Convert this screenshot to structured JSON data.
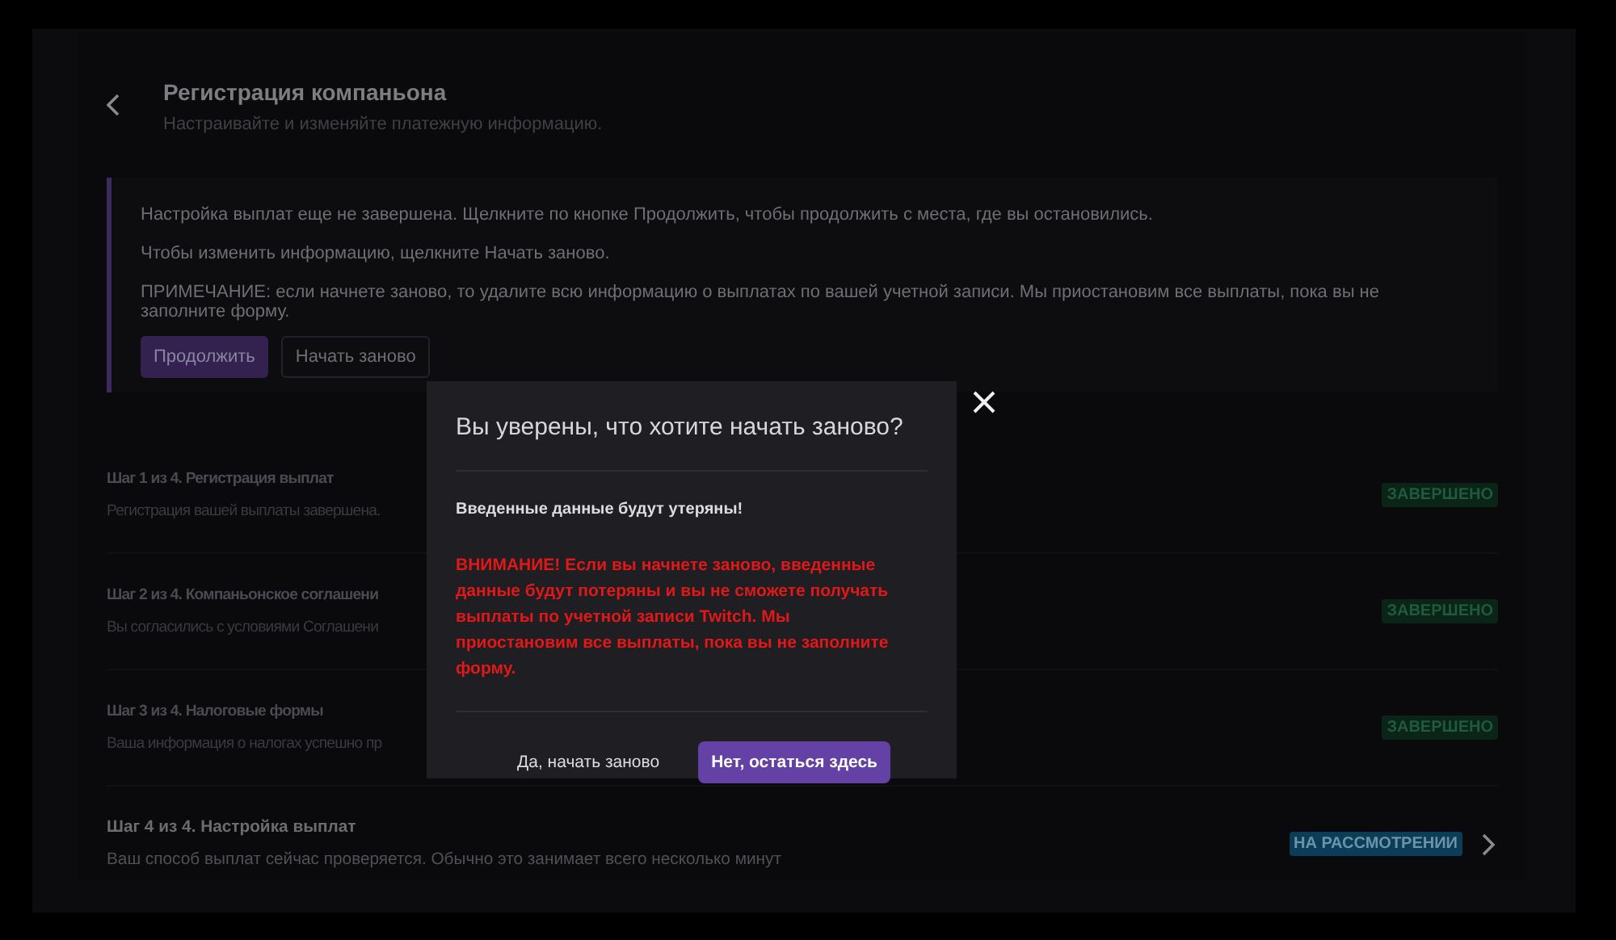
{
  "header": {
    "title": "Регистрация компаньона",
    "subtitle": "Настраивайте и изменяйте платежную информацию."
  },
  "notice": {
    "paragraphs": [
      "Настройка выплат еще не завершена. Щелкните по кнопке Продолжить, чтобы продолжить с места, где вы остановились.",
      "Чтобы изменить информацию, щелкните Начать заново.",
      "ПРИМЕЧАНИЕ: если начнете заново, то удалите всю информацию о выплатах по вашей учетной записи. Мы приостановим все выплаты, пока вы не заполните форму."
    ],
    "primary_button": "Продолжить",
    "secondary_button": "Начать заново"
  },
  "steps": [
    {
      "title": "Шаг 1 из 4. Регистрация выплат",
      "description": "Регистрация вашей выплаты завершена.",
      "status": "ЗАВЕРШЕНО",
      "kind": "complete",
      "disabled": true
    },
    {
      "title": "Шаг 2 из 4. Компаньонское соглашени",
      "description": "Вы согласились с условиями Соглашени",
      "status": "ЗАВЕРШЕНО",
      "kind": "complete",
      "disabled": true
    },
    {
      "title": "Шаг 3 из 4. Налоговые формы",
      "description": "Ваша информация о налогах успешно пр",
      "status": "ЗАВЕРШЕНО",
      "kind": "complete",
      "disabled": true
    },
    {
      "title": "Шаг 4 из 4. Настройка выплат",
      "description": "Ваш способ выплат сейчас проверяется. Обычно это занимает всего несколько минут",
      "status": "НА РАССМОТРЕНИИ",
      "kind": "review",
      "disabled": false
    }
  ],
  "dialog": {
    "title": "Вы уверены, что хотите начать заново?",
    "message": "Введенные данные будут утеряны!",
    "warning": "ВНИМАНИЕ! Если вы начнете заново, введенные данные будут потеряны и вы не сможете получать выплаты по учетной записи Twitch. Мы приостановим все выплаты, пока вы не заполните форму.",
    "confirm_button": "Да, начать заново",
    "cancel_button": "Нет, остаться здесь"
  }
}
